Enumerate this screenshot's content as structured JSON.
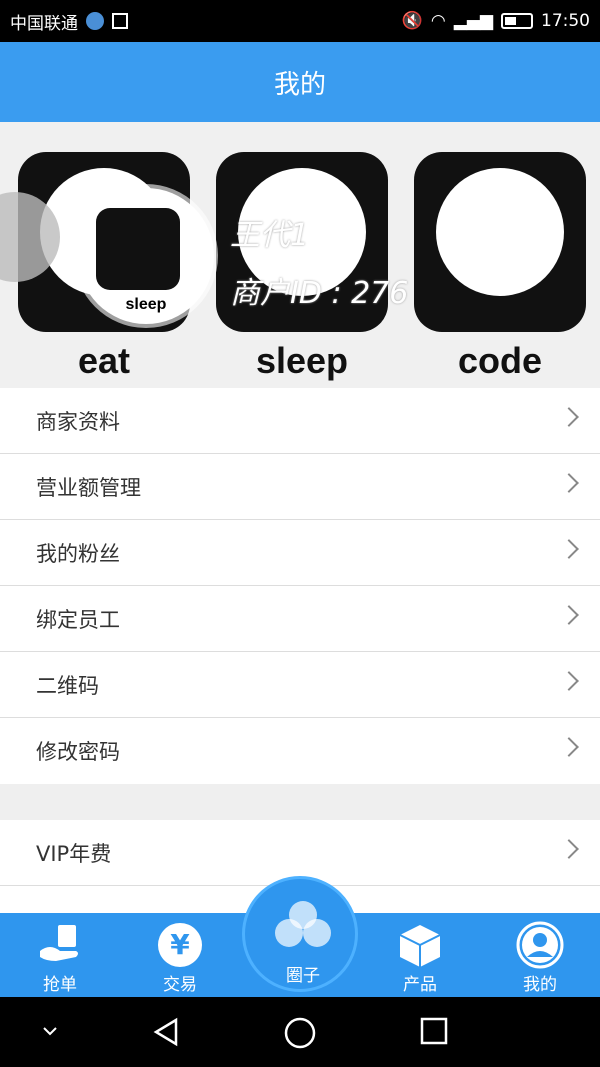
{
  "status_bar": {
    "carrier": "中国联通",
    "time": "17:50"
  },
  "header": {
    "title": "我的"
  },
  "banner": {
    "tile_labels": [
      "eat",
      "sleep",
      "code"
    ],
    "avatar_label": "sleep",
    "name": "王代1",
    "shop_id": "商户ID : 276"
  },
  "menu_group_1": [
    {
      "label": "商家资料"
    },
    {
      "label": "营业额管理"
    },
    {
      "label": "我的粉丝"
    },
    {
      "label": "绑定员工"
    },
    {
      "label": "二维码"
    },
    {
      "label": "修改密码"
    }
  ],
  "menu_group_2": [
    {
      "label": "VIP年费"
    }
  ],
  "bottom_nav": {
    "items": [
      {
        "label": "抢单",
        "icon": "hand-order-icon"
      },
      {
        "label": "交易",
        "icon": "yen-icon"
      },
      {
        "label": "圈子",
        "icon": "circles-icon"
      },
      {
        "label": "产品",
        "icon": "box-icon"
      },
      {
        "label": "我的",
        "icon": "person-icon"
      }
    ]
  },
  "colors": {
    "primary": "#3a9cf0",
    "nav": "#2f96ee"
  }
}
